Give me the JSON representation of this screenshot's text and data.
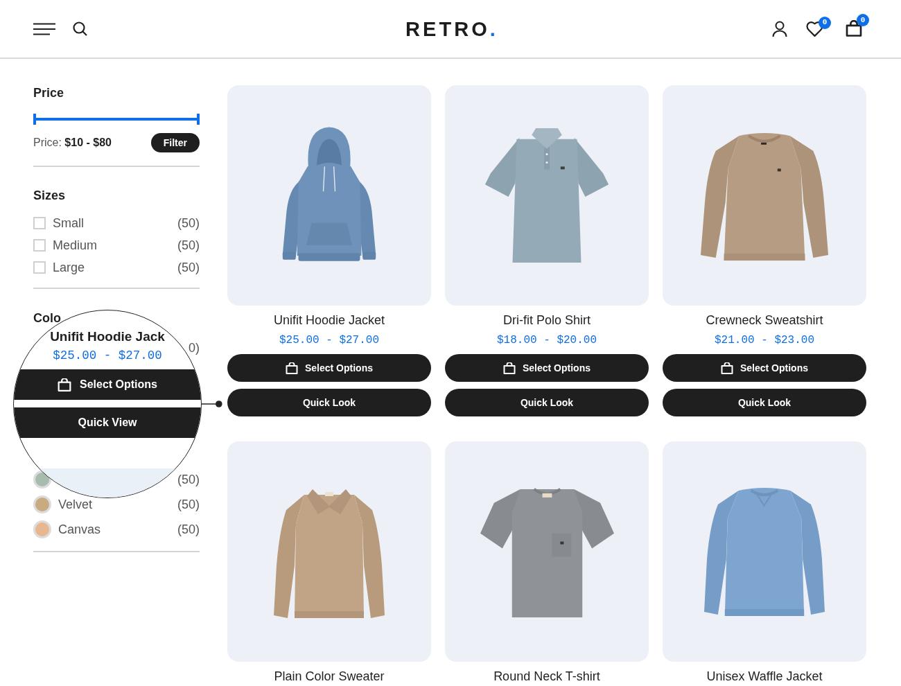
{
  "header": {
    "logo": {
      "text": "RETRO",
      "dot": "."
    },
    "wishlist_count": "0",
    "cart_count": "0"
  },
  "sidebar": {
    "price": {
      "title": "Price",
      "slider": {
        "level": 1
      },
      "range": "Price: **$10 - $80**",
      "filter_button": "Filter"
    },
    "sizes": {
      "title": "Sizes",
      "items": [
        {
          "label": "Small",
          "count": "(50)",
          "checked": false
        },
        {
          "label": "Medium",
          "count": "(50)",
          "checked": false
        },
        {
          "label": "Large",
          "count": "(50)",
          "checked": false
        }
      ]
    },
    "colors": {
      "title": "Colo",
      "items": [
        {
          "count": "0)"
        },
        {
          "color": "#a7bcae",
          "count": "(50)"
        },
        {
          "label": "Velvet",
          "color": "#c9ab80",
          "count": "(50)"
        },
        {
          "label": "Canvas",
          "color": "#e8b78f",
          "count": "(50)"
        }
      ]
    }
  },
  "magnifier": {
    "title": "Unifit Hoodie Jack",
    "price": "$25.00 - $27.00",
    "buttons": [
      {
        "kind": "options",
        "label": "Select Options"
      },
      {
        "kind": "quick-view",
        "label": "Quick View"
      }
    ]
  },
  "products": [
    {
      "kind": "hoodie",
      "name": "Unifit Hoodie Jacket",
      "price": "$25.00 - $27.00",
      "buttons": [
        {
          "kind": "options",
          "label": "Select Options"
        },
        {
          "kind": "quick-look",
          "label": "Quick Look"
        }
      ]
    },
    {
      "kind": "polo",
      "name": "Dri-fit Polo Shirt",
      "price": "$18.00 - $20.00",
      "buttons": [
        {
          "kind": "options",
          "label": "Select Options"
        },
        {
          "kind": "quick-look",
          "label": "Quick Look"
        }
      ]
    },
    {
      "kind": "sweatshirt",
      "name": "Crewneck Sweatshirt",
      "price": "$21.00 - $23.00",
      "buttons": [
        {
          "kind": "options",
          "label": "Select Options"
        },
        {
          "kind": "quick-look",
          "label": "Quick Look"
        }
      ]
    },
    {
      "kind": "collar-sweater",
      "name": "Plain Color Sweater"
    },
    {
      "kind": "tshirt",
      "name": "Round Neck T-shirt"
    },
    {
      "kind": "waffle-sweater",
      "name": "Unisex Waffle Jacket"
    }
  ]
}
